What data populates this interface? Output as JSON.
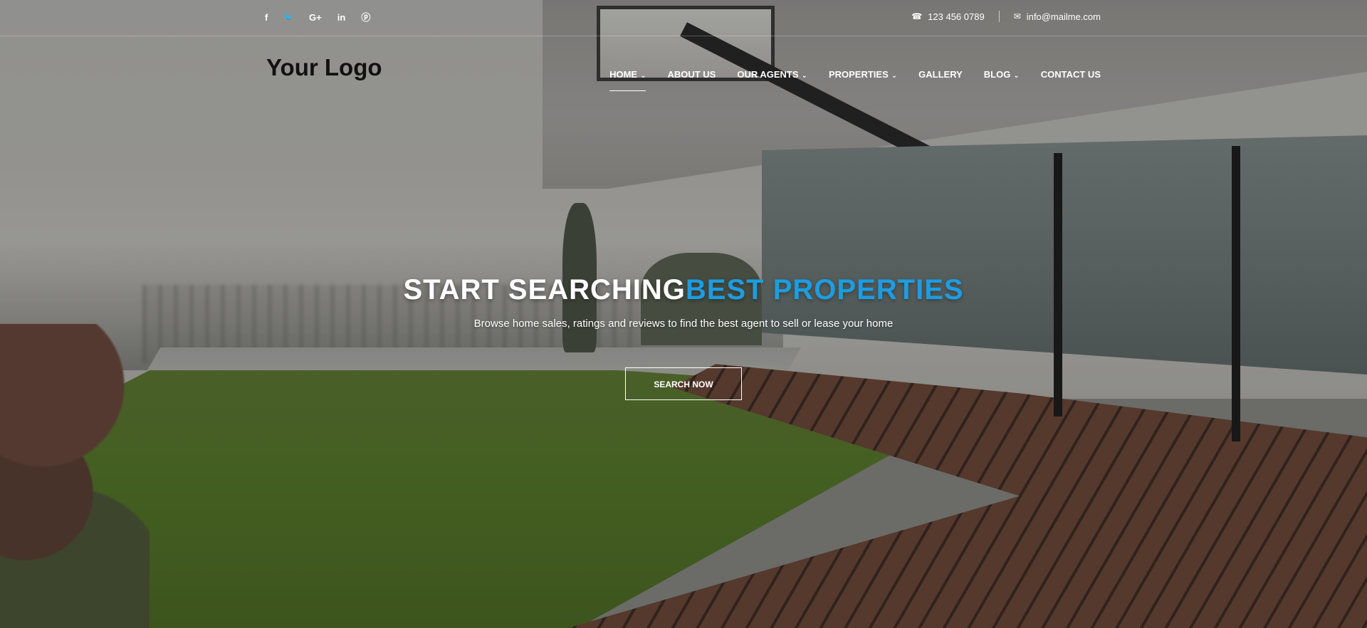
{
  "topbar": {
    "social": [
      {
        "icon": "facebook-icon",
        "glyph": "f"
      },
      {
        "icon": "twitter-icon",
        "glyph": "🐦"
      },
      {
        "icon": "google-plus-icon",
        "glyph": "G+"
      },
      {
        "icon": "linkedin-icon",
        "glyph": "in"
      },
      {
        "icon": "pinterest-icon",
        "glyph": "ⓟ"
      }
    ],
    "phone": "123 456 0789",
    "email": "info@mailme.com",
    "phone_icon": "phone-icon",
    "email_icon": "envelope-icon"
  },
  "header": {
    "logo": "Your Logo",
    "nav": [
      {
        "label": "HOME",
        "dropdown": true,
        "active": true
      },
      {
        "label": "ABOUT US",
        "dropdown": false
      },
      {
        "label": "OUR AGENTS",
        "dropdown": true
      },
      {
        "label": "PROPERTIES",
        "dropdown": true
      },
      {
        "label": "GALLERY",
        "dropdown": false
      },
      {
        "label": "BLOG",
        "dropdown": true
      },
      {
        "label": "CONTACT US",
        "dropdown": false
      }
    ]
  },
  "hero": {
    "headline_part1": "START SEARCHING",
    "headline_part2": "BEST PROPERTIES",
    "subline": "Browse home sales, ratings and reviews to find the best agent to sell or lease your home",
    "cta_label": "SEARCH NOW"
  },
  "colors": {
    "accent": "#1e9ce0",
    "text": "#ffffff",
    "logo": "#111111"
  }
}
